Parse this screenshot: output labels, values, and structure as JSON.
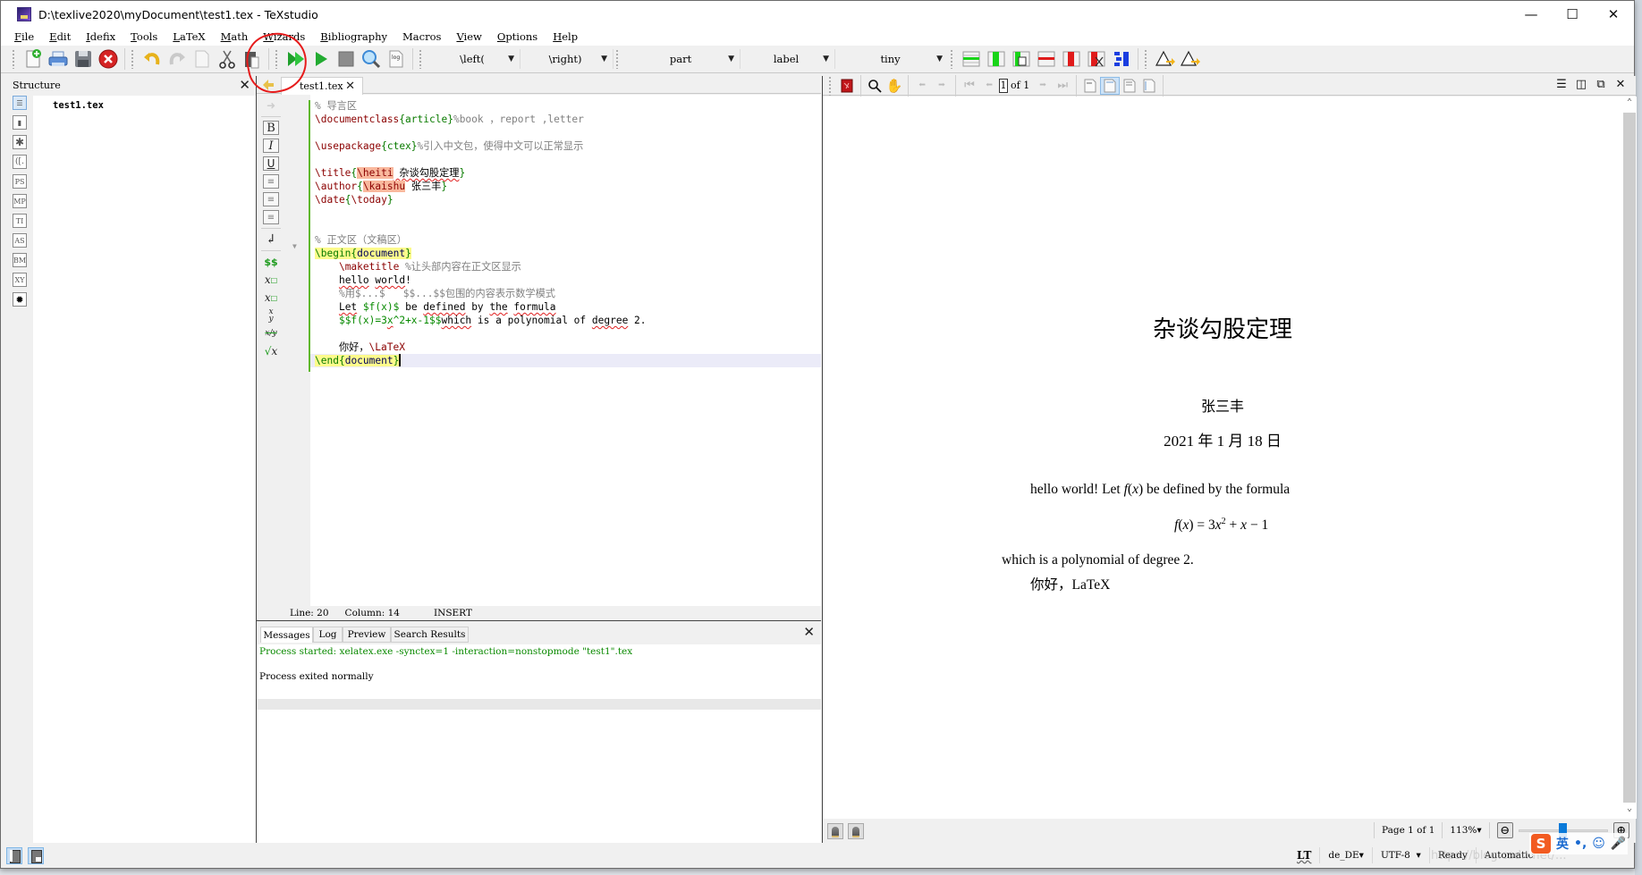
{
  "window": {
    "title": "D:\\texlive2020\\myDocument\\test1.tex - TeXstudio",
    "buttons": [
      "minimize",
      "maximize",
      "close"
    ]
  },
  "menu": [
    {
      "acc": "F",
      "rest": "ile"
    },
    {
      "acc": "E",
      "rest": "dit"
    },
    {
      "acc": "I",
      "rest": "defix"
    },
    {
      "acc": "T",
      "rest": "ools"
    },
    {
      "acc": "L",
      "rest": "aTeX"
    },
    {
      "acc": "M",
      "rest": "ath"
    },
    {
      "acc": "W",
      "rest": "izards"
    },
    {
      "acc": "B",
      "rest": "ibliography"
    },
    {
      "acc": "",
      "rest": "Macros"
    },
    {
      "acc": "V",
      "rest": "iew"
    },
    {
      "acc": "O",
      "rest": "ptions"
    },
    {
      "acc": "H",
      "rest": "elp"
    }
  ],
  "toolbar": {
    "file_icons": [
      "new-file-icon",
      "print-icon",
      "save-icon",
      "close-file-icon"
    ],
    "edit_icons": [
      "undo-icon",
      "redo-icon",
      "copy-icon",
      "cut-icon",
      "paste-icon"
    ],
    "build_icons": [
      "build-and-view-icon",
      "compile-icon",
      "stop-icon",
      "view-icon",
      "log-icon"
    ],
    "log_label": "log",
    "combos": [
      {
        "name": "left-delimiter",
        "value": "\\left("
      },
      {
        "name": "right-delimiter",
        "value": "\\right)"
      },
      {
        "name": "sectioning",
        "value": "part"
      },
      {
        "name": "references",
        "value": "label"
      },
      {
        "name": "size",
        "value": "tiny"
      }
    ],
    "table_icons": [
      "table-add-row-icon",
      "table-add-column-icon",
      "table-paste-column-icon",
      "table-remove-row-icon",
      "table-remove-column-icon",
      "table-cut-column-icon",
      "table-align-icon"
    ],
    "warning_icons": [
      "previous-error-icon",
      "next-error-icon"
    ],
    "annotation_color": "#e61b1b"
  },
  "structure": {
    "title": "Structure",
    "root": "test1.tex",
    "side_icons": [
      "structure",
      "bookmarks",
      "symbols",
      "brackets",
      "PS",
      "MP",
      "TI",
      "AS",
      "BM",
      "XY",
      "special"
    ]
  },
  "editor": {
    "tab_label": "test1.tex",
    "lines": {
      "l1": "% 导言区",
      "l2_cmd": "\\documentclass",
      "l2_arg": "article",
      "l2_com": "%book ，report ,letter",
      "l4_cmd": "\\usepackage",
      "l4_arg": "ctex",
      "l4_com": "%引入中文包，使得中文可以正常显示",
      "l6_cmd": "\\title",
      "l6_hl": "\\heiti",
      "l6_text": " 杂谈勾股定理",
      "l7_cmd": "\\author",
      "l7_hl": "\\kaishu",
      "l7_text": " 张三丰",
      "l8_cmd": "\\date",
      "l8_inner": "\\today",
      "l11": "% 正文区（文稿区）",
      "l12_cmd": "\\begin",
      "l12_arg": "document",
      "l13_cmd": "\\maketitle",
      "l13_com": " %让头部内容在正文区显示",
      "l14_a": "hello",
      "l14_b": "world",
      "l14_c": "!",
      "l15": "%用$...$   $$...$$包围的内容表示数学模式",
      "l16_let": "Let",
      "l16_math": "$f(x)$",
      "l16_be": " be ",
      "l16_defined": "defined",
      "l16_by": " by ",
      "l16_the": "the",
      "l16_formula": "formula",
      "l17_math1": "$$f(x)=3",
      "l17_x": "x",
      "l17_math2": "^2+x-1$$",
      "l17_which": "which",
      "l17_rest": " is a polynomial of ",
      "l17_degree": "degree",
      "l17_end": " 2.",
      "l19_text": "你好，",
      "l19_cmd": "\\LaTeX",
      "l20_cmd": "\\end",
      "l20_arg": "document"
    },
    "status": {
      "line": "Line: 20",
      "column": "Column: 14",
      "mode": "INSERT"
    }
  },
  "messages": {
    "tabs": [
      "Messages",
      "Log",
      "Preview",
      "Search Results"
    ],
    "active_tab": "Messages",
    "started": "Process started: xelatex.exe -synctex=1 -interaction=nonstopmode \"test1\".tex",
    "exited": "Process exited normally"
  },
  "pdf": {
    "page_input": "1",
    "page_of": "of 1",
    "document": {
      "title": "杂谈勾股定理",
      "author": "张三丰",
      "date": "2021 年 1 月 18 日",
      "p1_a": "hello world! Let ",
      "p1_fx": "f",
      "p1_x": "x",
      "p1_b": " be defined by the formula",
      "eq_lhs_f": "f",
      "eq_lhs_x": "x",
      "eq_mid": ") = 3",
      "eq_x": "x",
      "eq_sup": "2",
      "eq_plus": " + ",
      "eq_x2": "x",
      "eq_end": " − 1",
      "p2": "which is a polynomial of degree 2.",
      "p3_text": "你好，",
      "p3_latex": "LaTeX"
    },
    "page_status": "Page 1 of 1",
    "zoom": "113%",
    "zoom_slider_fraction": 0.5
  },
  "statusbar": {
    "lt": "LT",
    "language": "de_DE",
    "encoding": "UTF-8",
    "state": "Ready",
    "mode": "Automatic"
  },
  "ime": {
    "lang": "英"
  },
  "watermark": "https://blog.csdn.net/..."
}
